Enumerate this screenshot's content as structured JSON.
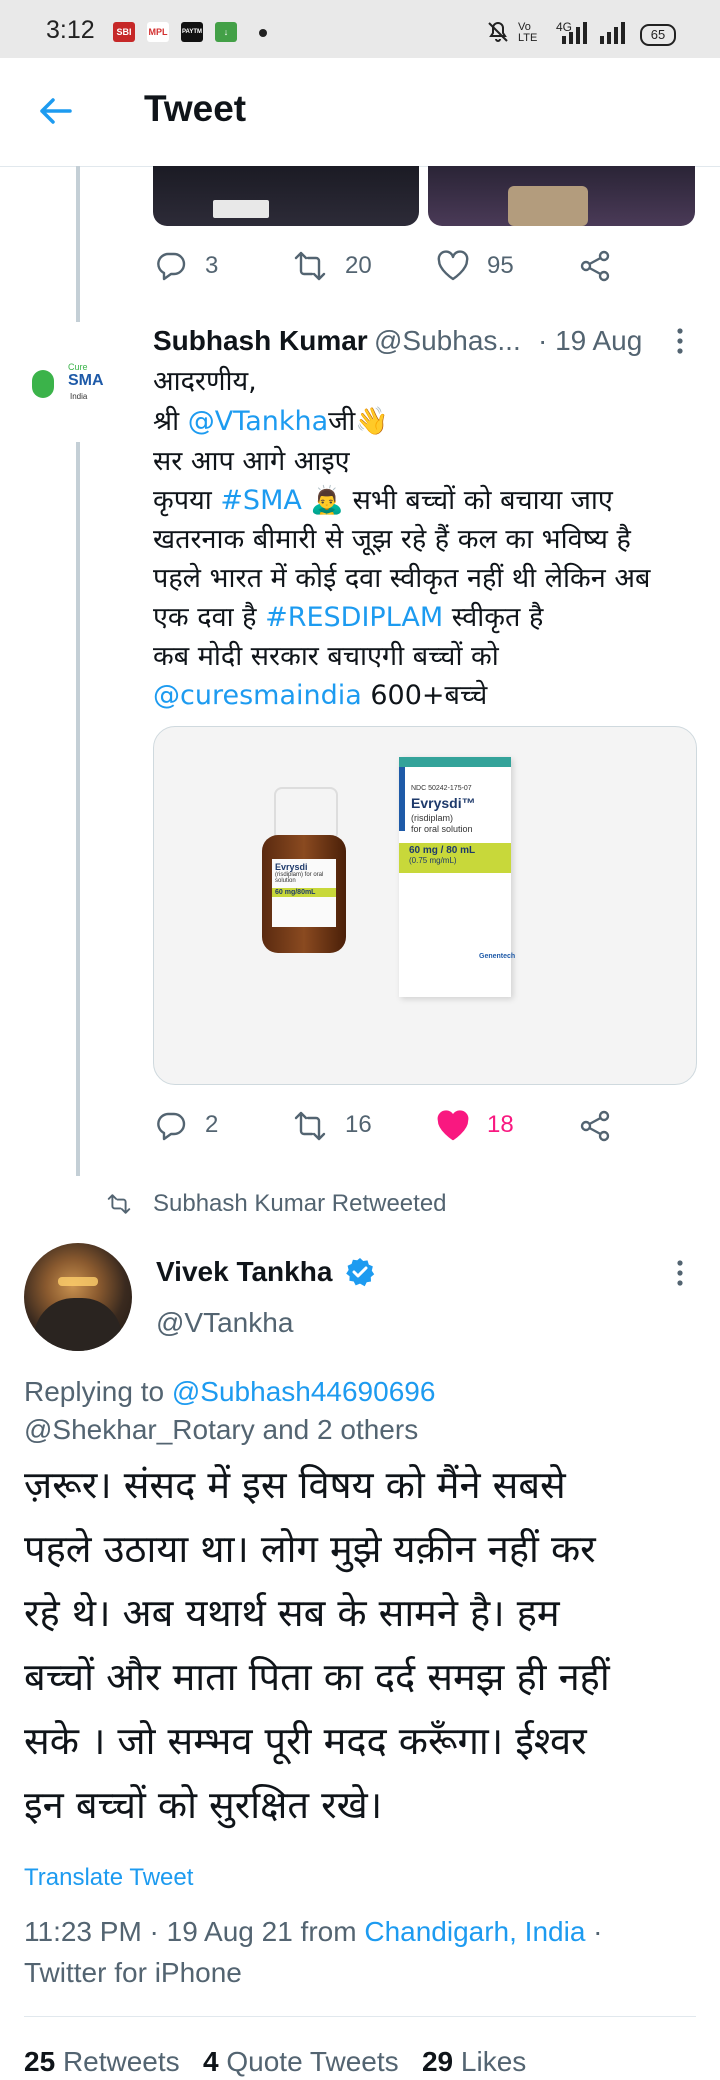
{
  "status_bar": {
    "time": "3:12",
    "apps": [
      "SBI",
      "MPL",
      "PAYTM",
      "download"
    ],
    "network": "4G",
    "battery": "65"
  },
  "header": {
    "title": "Tweet",
    "back_icon": "arrow-left-icon"
  },
  "prev_tweet_actions": {
    "replies": "3",
    "retweets": "20",
    "likes": "95"
  },
  "reply_tweet": {
    "name": "Subhash Kumar",
    "handle": "@Subhas...",
    "date": "· 19 Aug",
    "avatar_text": {
      "cure": "Cure",
      "sma": "SMA",
      "india": "India"
    },
    "lines": {
      "l1": "आदरणीय,",
      "l2_prefix": "श्री ",
      "l2_mention": "@VTankha",
      "l2_suffix": "जी👋",
      "l3": "सर आप आगे आइए",
      "l4_prefix": "कृपया ",
      "l4_tag": "#SMA",
      "l4_suffix": " 🙇‍♂️ सभी बच्चों को बचाया जाए",
      "l5": "खतरनाक बीमारी से जूझ रहे हैं कल का भविष्य है",
      "l6": "पहले भारत में कोई दवा स्वीकृत नहीं थी लेकिन अब",
      "l7_prefix": "एक दवा है ",
      "l7_tag": "#RESDIPLAM",
      "l7_suffix": " स्वीकृत है",
      "l8": "कब मोदी सरकार बचाएगी बच्चों को",
      "l9_mention": "@curesmaindia",
      "l9_suffix": " 600+बच्चे"
    },
    "media": {
      "bottle_label": "Evrysdi",
      "bottle_sub": "(risdiplam) for oral solution",
      "bottle_dose": "60 mg/80mL",
      "box_ndc": "NDC 50242-175-07",
      "box_brand": "Evrysdi™",
      "box_generic": "(risdiplam)",
      "box_form": "for oral solution",
      "box_dose": "60 mg / 80 mL",
      "box_conc": "(0.75 mg/mL)",
      "box_mfr": "Genentech"
    },
    "actions": {
      "replies": "2",
      "retweets": "16",
      "likes": "18"
    }
  },
  "retweet_notice": "Subhash Kumar Retweeted",
  "main_tweet": {
    "name": "Vivek Tankha",
    "handle": "@VTankha",
    "replying_prefix": "Replying to ",
    "replying_to": "@Subhash44690696",
    "replying_line2": "@Shekhar_Rotary and 2 others",
    "text_lines": [
      "ज़रूर। संसद में इस विषय को मैंने सबसे",
      "पहले उठाया था। लोग मुझे यक़ीन नहीं कर",
      "रहे थे। अब यथार्थ सब के सामने है। हम",
      "बच्चों और माता पिता का दर्द समझ ही नहीं",
      "सके । जो सम्भव पूरी मदद करूँगा। ईश्वर",
      "इन बच्चों को सुरक्षित रखे।"
    ],
    "translate": "Translate Tweet",
    "timestamp": "11:23 PM · 19 Aug 21 from ",
    "location": "Chandigarh, India",
    "sep": " ·",
    "client": "Twitter for iPhone",
    "stats": {
      "retweets_count": "25",
      "retweets_label": "Retweets",
      "quotes_count": "4",
      "quotes_label": "Quote Tweets",
      "likes_count": "29",
      "likes_label": "Likes"
    }
  },
  "colors": {
    "link": "#1d9bf0",
    "like_active": "#f91880",
    "verified": "#1d9bf0"
  }
}
